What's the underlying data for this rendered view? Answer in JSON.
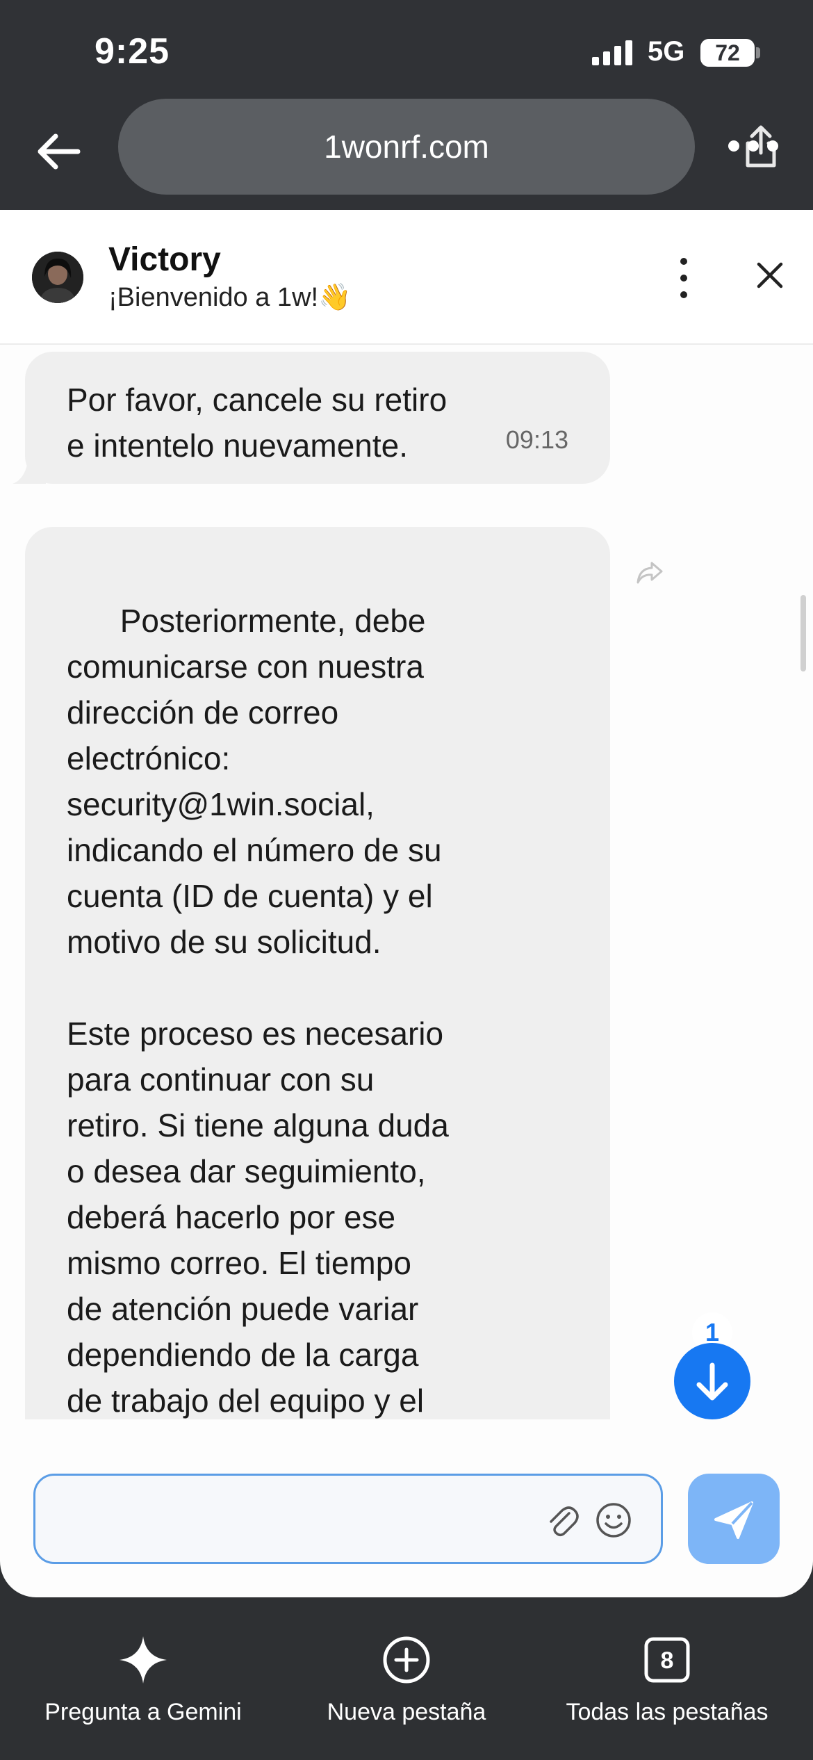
{
  "status_bar": {
    "time": "9:25",
    "network": "5G",
    "battery": "72"
  },
  "browser": {
    "url": "1wonrf.com",
    "icons": [
      "back-arrow-icon",
      "share-icon",
      "more-dots-icon"
    ]
  },
  "chat": {
    "agent_name": "Victory",
    "agent_subtitle": "¡Bienvenido a 1w!👋",
    "messages": [
      {
        "text": "Por favor, cancele su retiro\ne intentelo nuevamente.",
        "time": "09:13"
      },
      {
        "text": "Posteriormente, debe\ncomunicarse con nuestra\ndirección de correo\nelectrónico:\nsecurity@1win.social,\nindicando el número de su\ncuenta (ID de cuenta) y el\nmotivo de su solicitud.\n\nEste proceso es necesario\npara continuar con su\nretiro. Si tiene alguna duda\no desea dar seguimiento,\ndeberá hacerlo por ese\nmismo correo. El tiempo\nde atención puede variar\ndependiendo de la carga\nde trabajo del equipo y el\norden de llegada del"
      }
    ],
    "unread_count": "1",
    "input_placeholder": "",
    "accent_color": "#1778f2"
  },
  "bottom_bar": {
    "items": [
      {
        "label": "Pregunta a Gemini",
        "icon": "gemini-sparkle-icon"
      },
      {
        "label": "Nueva pestaña",
        "icon": "new-tab-plus-icon"
      },
      {
        "label": "Todas las pestañas",
        "icon": "tabs-count-icon",
        "count": "8"
      }
    ]
  }
}
